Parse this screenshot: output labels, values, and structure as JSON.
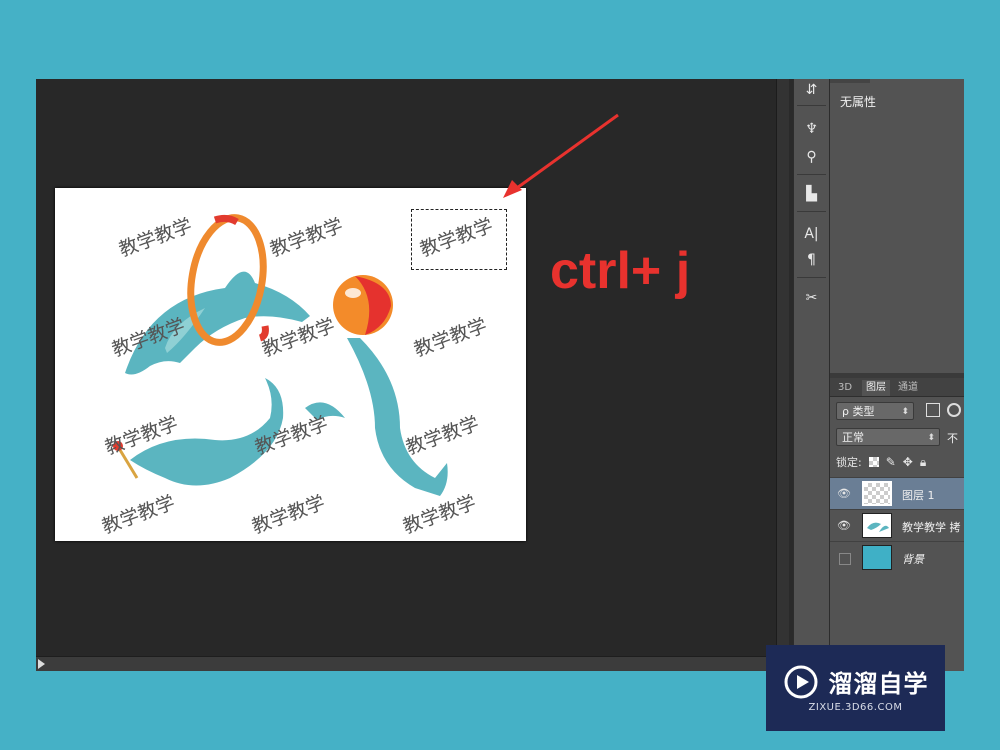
{
  "properties_panel": {
    "title": "无属性"
  },
  "layers_panel": {
    "tabs": [
      {
        "label": "3D"
      },
      {
        "label": "图层"
      },
      {
        "label": "通道"
      }
    ],
    "filter_label": "ρ 类型",
    "blend_mode": "正常",
    "opacity_label": "不",
    "lock_label": "锁定:",
    "layers": [
      {
        "name": "图层 1",
        "visible": true,
        "selected": true
      },
      {
        "name": "教学教学 拷",
        "visible": true,
        "selected": false
      },
      {
        "name": "背景",
        "visible": false,
        "selected": false
      }
    ]
  },
  "document": {
    "watermark_text": "教学教学"
  },
  "annotation": {
    "handwritten_text": "ctrl+ j",
    "color": "#e8322e"
  },
  "brand": {
    "name": "溜溜自学",
    "url": "ZIXUE.3D66.COM"
  },
  "colors": {
    "background": "#45b1c6",
    "workspace": "#282828",
    "panel": "#535353",
    "selected_layer": "#6a7e95",
    "brand_bg": "#1d2a56"
  }
}
